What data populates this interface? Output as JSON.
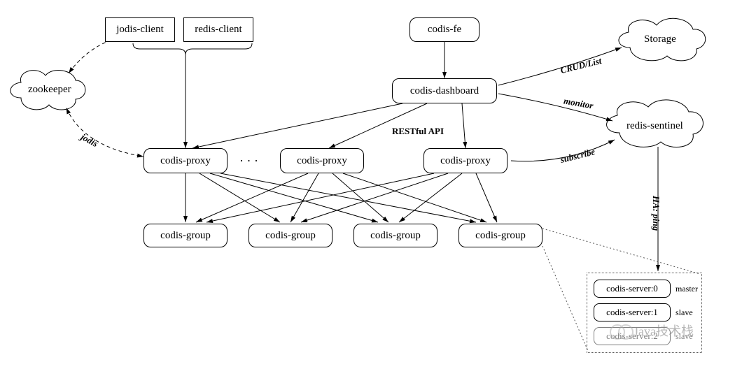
{
  "nodes": {
    "jodis_client": "jodis-client",
    "redis_client": "redis-client",
    "codis_fe": "codis-fe",
    "zookeeper": "zookeeper",
    "codis_dashboard": "codis-dashboard",
    "storage": "Storage",
    "redis_sentinel": "redis-sentinel",
    "codis_proxy": "codis-proxy",
    "codis_group": "codis-group",
    "codis_server_0": "codis-server:0",
    "codis_server_1": "codis-server:1",
    "codis_server_2": "codis-server:2"
  },
  "labels": {
    "jodis": "jodis",
    "crud_list": "CRUD/List",
    "monitor": "monitor",
    "restful_api": "RESTful API",
    "subscribe": "subscribe",
    "ha_ping": "HA: ping",
    "master": "master",
    "slave": "slave",
    "dots": "· · ·"
  },
  "watermark": "Java技术栈"
}
